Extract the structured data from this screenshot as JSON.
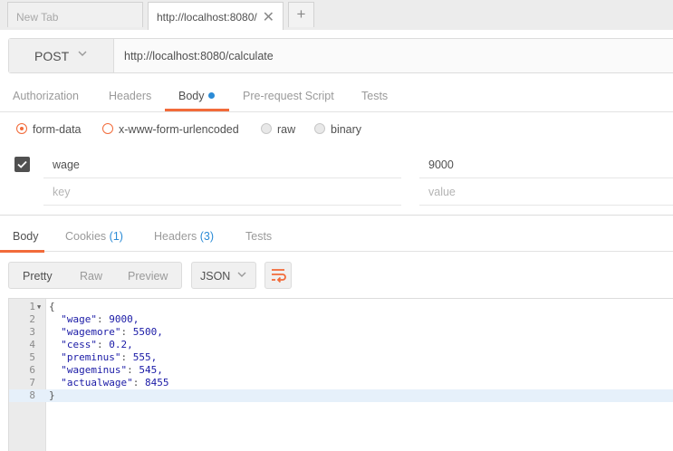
{
  "tabs": [
    {
      "label": "New Tab"
    },
    {
      "label": "http://localhost:8080/"
    }
  ],
  "request": {
    "method": "POST",
    "url": "http://localhost:8080/calculate"
  },
  "request_tabs": [
    "Authorization",
    "Headers",
    "Body",
    "Pre-request Script",
    "Tests"
  ],
  "body_options": [
    "form-data",
    "x-www-form-urlencoded",
    "raw",
    "binary"
  ],
  "params": [
    {
      "key": "wage",
      "value": "9000"
    }
  ],
  "param_placeholder": {
    "key": "key",
    "value": "value"
  },
  "response_tabs": {
    "body": "Body",
    "cookies": "Cookies",
    "cookies_count": "(1)",
    "headers": "Headers",
    "headers_count": "(3)",
    "tests": "Tests"
  },
  "view_modes": [
    "Pretty",
    "Raw",
    "Preview"
  ],
  "format": "JSON",
  "code_lines": [
    {
      "n": "1",
      "text": "{"
    },
    {
      "n": "2",
      "k": "\"wage\"",
      "v": "9000,"
    },
    {
      "n": "3",
      "k": "\"wagemore\"",
      "v": "5500,"
    },
    {
      "n": "4",
      "k": "\"cess\"",
      "v": "0.2,"
    },
    {
      "n": "5",
      "k": "\"preminus\"",
      "v": "555,"
    },
    {
      "n": "6",
      "k": "\"wageminus\"",
      "v": "545,"
    },
    {
      "n": "7",
      "k": "\"actualwage\"",
      "v": "8455"
    },
    {
      "n": "8",
      "text": "}"
    }
  ],
  "colors": {
    "accent": "#f26b3a",
    "link": "#2b8bd6"
  }
}
